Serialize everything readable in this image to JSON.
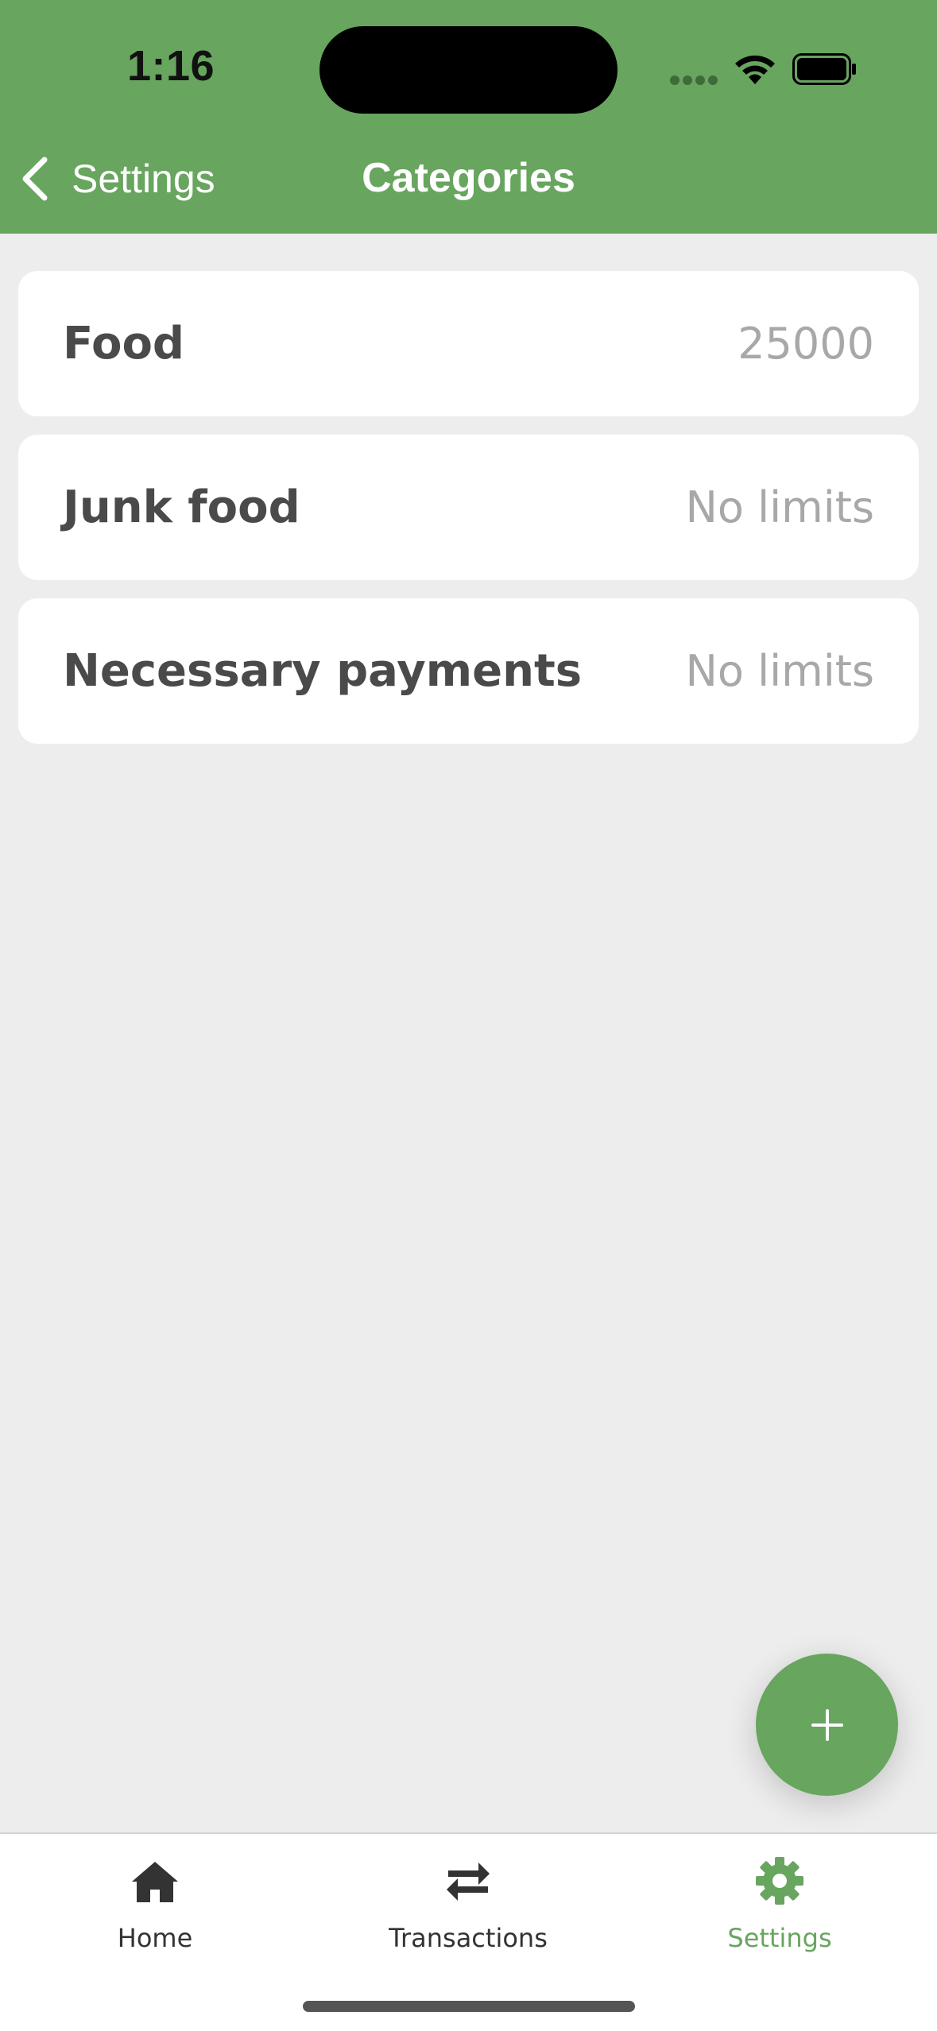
{
  "status_bar": {
    "time": "1:16"
  },
  "nav": {
    "back_label": "Settings",
    "title": "Categories"
  },
  "categories": [
    {
      "name": "Food",
      "limit": "25000"
    },
    {
      "name": "Junk food",
      "limit": "No limits"
    },
    {
      "name": "Necessary payments",
      "limit": "No limits"
    }
  ],
  "fab": {
    "icon": "plus-icon"
  },
  "tabs": [
    {
      "label": "Home",
      "icon": "home-icon",
      "active": false
    },
    {
      "label": "Transactions",
      "icon": "swap-arrows-icon",
      "active": false
    },
    {
      "label": "Settings",
      "icon": "gear-icon",
      "active": true
    }
  ],
  "colors": {
    "accent": "#68a55f",
    "background": "#ededed",
    "muted_text": "#a8a8a8"
  }
}
